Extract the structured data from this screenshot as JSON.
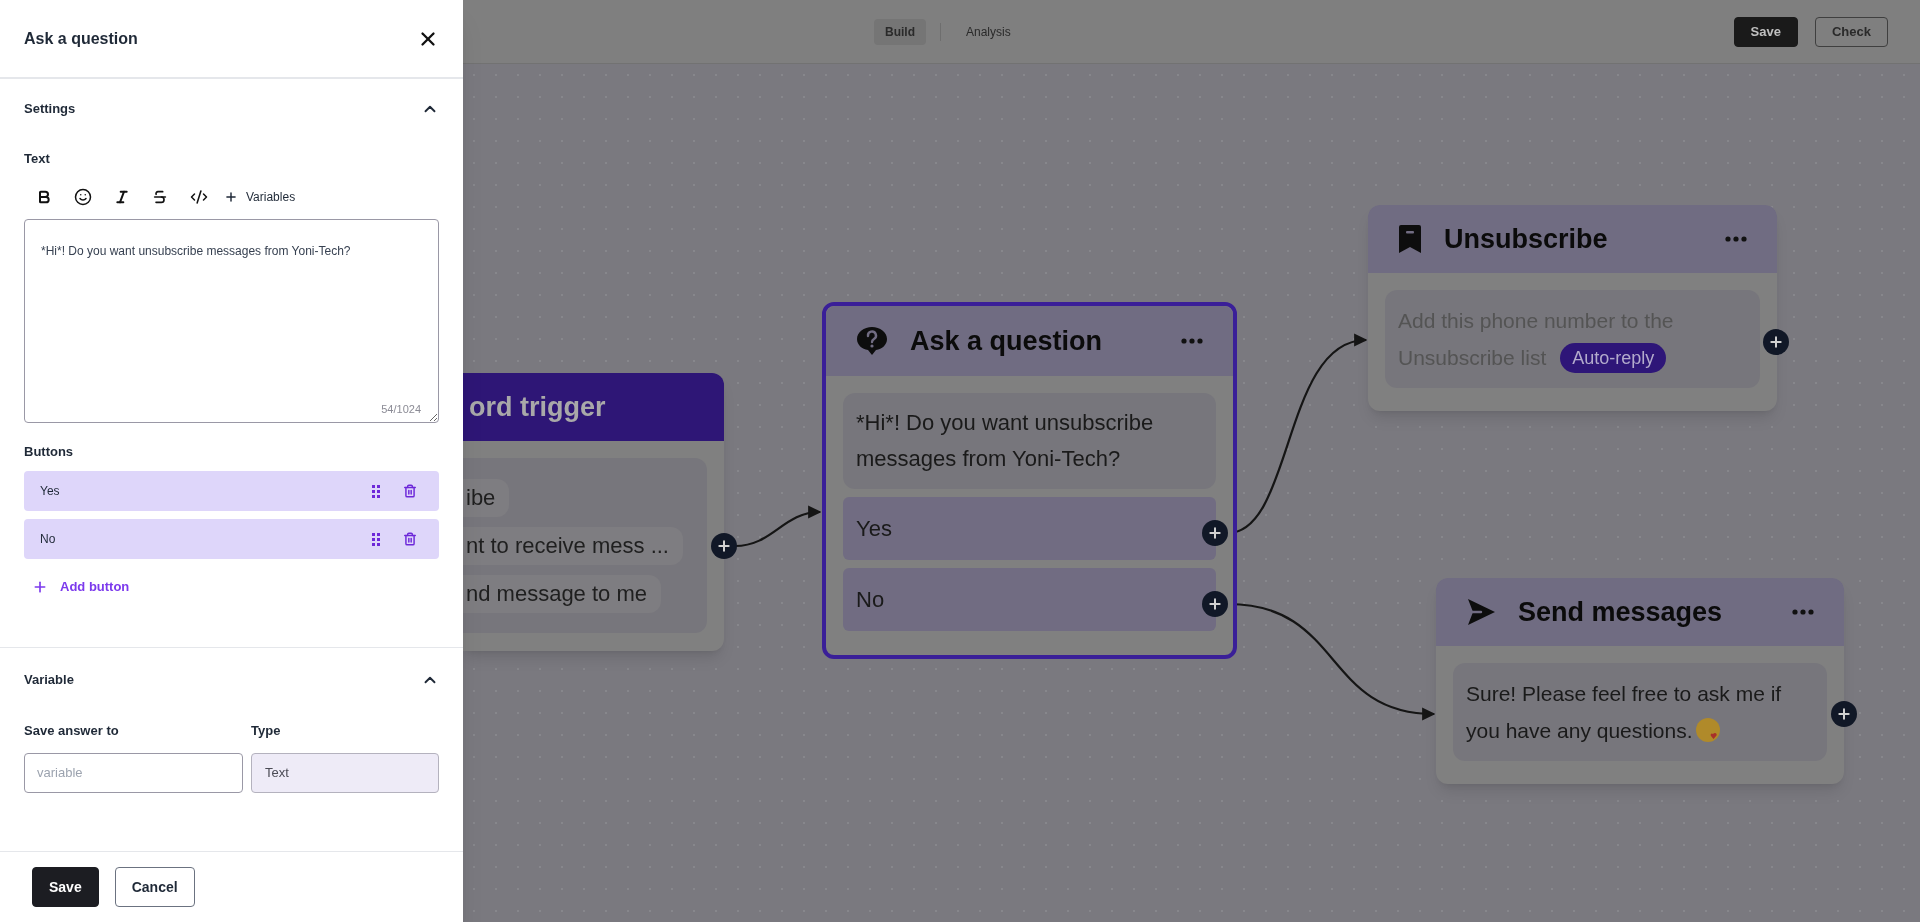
{
  "side_panel": {
    "title": "Ask a question",
    "settings_section": {
      "title": "Settings",
      "expanded": true
    },
    "text_label": "Text",
    "toolbar": {
      "variables_label": "Variables"
    },
    "message_text": "*Hi*! Do you want unsubscribe messages from Yoni-Tech?",
    "char_count": "54/1024",
    "buttons_label": "Buttons",
    "buttons": [
      {
        "label": "Yes"
      },
      {
        "label": "No"
      }
    ],
    "add_button": "Add button",
    "variable_section": {
      "title": "Variable",
      "expanded": true
    },
    "save_answer_label": "Save answer to",
    "variable_placeholder": "variable",
    "type_label": "Type",
    "type_value": "Text",
    "footer_buttons": [
      {
        "label": "Save",
        "kind": "primary"
      },
      {
        "label": "Cancel",
        "kind": "secondary"
      }
    ]
  },
  "top_bar": {
    "tabs": [
      {
        "label": "Build",
        "selected": true
      },
      {
        "label": "Analysis",
        "selected": false
      }
    ],
    "actions": [
      {
        "label": "Save",
        "kind": "primary"
      },
      {
        "label": "Check",
        "kind": "secondary"
      }
    ]
  },
  "canvas": {
    "nodes": [
      {
        "kind": "trigger",
        "title": "ord trigger",
        "keywords": [
          "ibe",
          "nt to receive mess ...",
          "nd message to me"
        ]
      },
      {
        "kind": "question",
        "title": "Ask a question",
        "selected": true,
        "text": "*Hi*! Do you want unsubscribe messages from Yoni-Tech?",
        "buttons": [
          "Yes",
          "No"
        ]
      },
      {
        "kind": "unsubscribe",
        "title": "Unsubscribe",
        "text_lines": [
          "Add this phone number to the",
          "Unsubscribe list"
        ],
        "tag": "Auto-reply"
      },
      {
        "kind": "send",
        "title": "Send messages",
        "text": "Sure! Please feel free to ask me if you have any questions.",
        "emoji": true
      }
    ]
  }
}
